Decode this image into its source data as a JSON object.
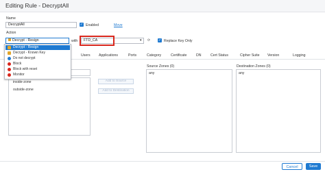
{
  "window": {
    "title": "Editing Rule - DecryptAll"
  },
  "form": {
    "name_label": "Name",
    "name_value": "DecryptAll",
    "enabled_label": "Enabled",
    "move_label": "Move",
    "action_label": "Action",
    "action_value": "Decrypt - Resign",
    "with_label": "with",
    "cert_value": "FTD_CA",
    "refresh_icon": "refresh-icon",
    "replace_key_label": "Replace Key Only"
  },
  "action_menu": {
    "items": [
      {
        "label": "Decrypt - Resign",
        "icon": "lock-icon",
        "selected": true
      },
      {
        "label": "Decrypt - Known Key",
        "icon": "lock-icon",
        "selected": false
      },
      {
        "label": "Do not decrypt",
        "icon": "no-decrypt-icon",
        "color": "#1f7ad1",
        "selected": false
      },
      {
        "label": "Block",
        "icon": "block-icon",
        "color": "#d9261c",
        "selected": false
      },
      {
        "label": "Block with reset",
        "icon": "block-reset-icon",
        "color": "#d9261c",
        "selected": false
      },
      {
        "label": "Monitor",
        "icon": "monitor-icon",
        "color": "#d9261c",
        "selected": false
      }
    ]
  },
  "tabs": [
    "Users",
    "Applications",
    "Ports",
    "Category",
    "Certificate",
    "DN",
    "Cert Status",
    "Cipher Suite",
    "Version",
    "Logging"
  ],
  "zones": {
    "available": [
      "inside-zone",
      "outside-zone"
    ],
    "add_to_source": "Add to Source",
    "add_to_destination": "Add to Destination",
    "source_header": "Source Zones (0)",
    "source_value": "any",
    "dest_header": "Destination Zones (0)",
    "dest_value": "any"
  },
  "footer": {
    "cancel": "Cancel",
    "save": "Save"
  },
  "colors": {
    "accent": "#1f7ad1",
    "highlight": "#d9261c"
  }
}
